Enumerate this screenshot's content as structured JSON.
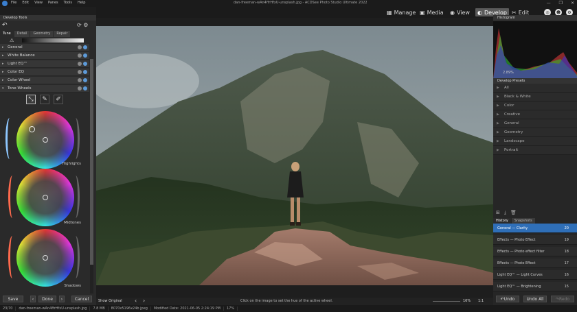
{
  "titlebar": {
    "menu": [
      "File",
      "Edit",
      "View",
      "Panes",
      "Tools",
      "Help"
    ],
    "doc_title": "dan-freeman-wAn4ffrHfxU-unsplash.jpg - ACDSee Photo Studio Ultimate 2022",
    "window_buttons": [
      "—",
      "❐",
      "✕"
    ]
  },
  "modes": [
    {
      "label": "Manage",
      "icon": "grid-icon"
    },
    {
      "label": "Media",
      "icon": "media-icon"
    },
    {
      "label": "View",
      "icon": "eye-icon"
    },
    {
      "label": "Develop",
      "icon": "develop-icon",
      "active": true
    },
    {
      "label": "Edit",
      "icon": "edit-icon"
    }
  ],
  "left_panel": {
    "title": "Develop Tools",
    "tabs": [
      "Tune",
      "Detail",
      "Geometry",
      "Repair"
    ],
    "sections": [
      {
        "label": "General"
      },
      {
        "label": "White Balance"
      },
      {
        "label": "Light EQ™"
      },
      {
        "label": "Color EQ"
      },
      {
        "label": "Color Wheel"
      },
      {
        "label": "Tone Wheels"
      }
    ],
    "wheels": [
      {
        "label": "Highlights"
      },
      {
        "label": "Midtones"
      },
      {
        "label": "Shadows"
      }
    ],
    "buttons": {
      "save": "Save",
      "done": "Done",
      "cancel": "Cancel"
    }
  },
  "canvas_toolbar": {
    "show_original": "Show Original",
    "hint": "Click on the image to set the hue of the active wheel.",
    "zoom": "16%",
    "ratio": "1:1"
  },
  "statusbar": {
    "index": "23/70",
    "filename": "dan-freeman-wAn4ffrHfxU-unsplash.jpg",
    "filesize": "7.8 MB",
    "dimensions": "8070x5196x24b jpeg",
    "modified": "Modified Date: 2021-06-05 2:24:19 PM",
    "zoom": "17%"
  },
  "right_panel": {
    "histogram_title": "Histogram",
    "histogram_value": "2.89%",
    "presets_title": "Develop Presets",
    "presets": [
      "All",
      "Black & White",
      "Color",
      "Creative",
      "General",
      "Geometry",
      "Landscape",
      "Portrait"
    ],
    "history_tabs": [
      "History",
      "Snapshots"
    ],
    "history": [
      {
        "label": "General — Clarity",
        "n": "20",
        "active": true
      },
      {
        "label": "Effects — Photo Effect",
        "n": "19"
      },
      {
        "label": "Effects — Photo effect filter",
        "n": "18"
      },
      {
        "label": "Effects — Photo Effect",
        "n": "17"
      },
      {
        "label": "Light EQ™ — Light Curves",
        "n": "16"
      },
      {
        "label": "Light EQ™ — Brightening",
        "n": "15"
      }
    ],
    "undo": "Undo",
    "undo_all": "Undo All",
    "redo": "Redo"
  }
}
